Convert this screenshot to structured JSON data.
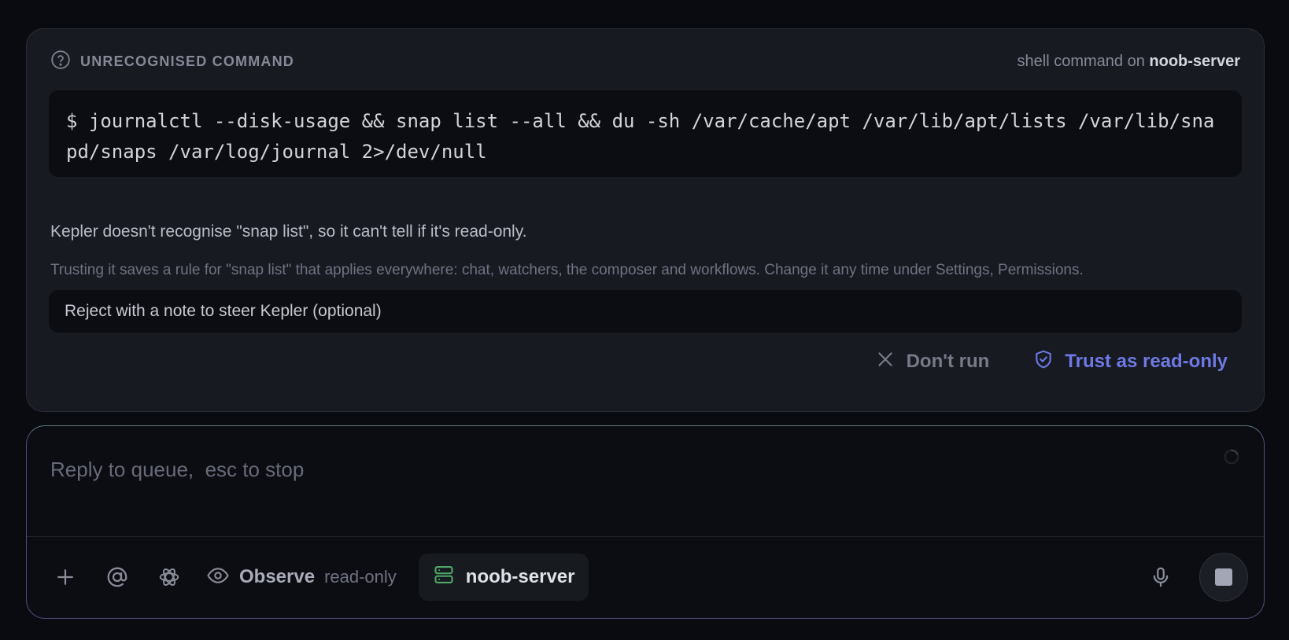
{
  "approval": {
    "title": "UNRECOGNISED COMMAND",
    "context_prefix": "shell command on ",
    "context_server": "noob-server",
    "command": "$ journalctl --disk-usage && snap list --all && du -sh /var/cache/apt /var/lib/apt/lists /var/lib/snapd/snaps /var/log/journal 2>/dev/null",
    "explanation": "Kepler doesn't recognise \"snap list\", so it can't tell if it's read-only.",
    "hint": "Trusting it saves a rule for \"snap list\" that applies everywhere: chat, watchers, the composer and workflows. Change it any time under Settings, Permissions.",
    "note_placeholder": "Reject with a note to steer Kepler (optional)",
    "reject_label": "Don't run",
    "trust_label": "Trust as read-only"
  },
  "composer": {
    "placeholder": "Reply to queue,  esc to stop",
    "mode_label": "Observe",
    "mode_sub": "read-only",
    "server": "noob-server"
  },
  "colors": {
    "accent": "#6f79e6",
    "server_icon": "#4fa86a"
  }
}
